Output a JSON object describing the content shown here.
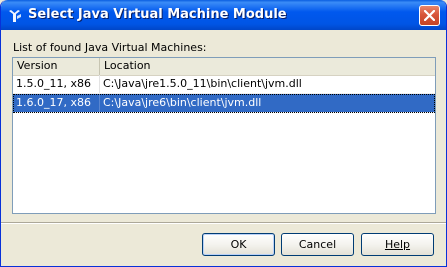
{
  "window": {
    "title": "Select Java Virtual Machine Module",
    "title_icon": "netbeans-icon",
    "close_icon": "close-icon"
  },
  "list": {
    "label": "List of found Java Virtual Machines:",
    "columns": [
      "Version",
      "Location"
    ],
    "rows": [
      {
        "version": "1.5.0_11, x86",
        "location": "C:\\Java\\jre1.5.0_11\\bin\\client\\jvm.dll",
        "selected": false
      },
      {
        "version": "1.6.0_17, x86",
        "location": "C:\\Java\\jre6\\bin\\client\\jvm.dll",
        "selected": true
      }
    ]
  },
  "buttons": {
    "ok": "OK",
    "cancel": "Cancel",
    "help": "Help"
  },
  "colors": {
    "titlebar": "#0058ee",
    "selection": "#316ac5",
    "dialog_bg": "#ece9d8"
  }
}
